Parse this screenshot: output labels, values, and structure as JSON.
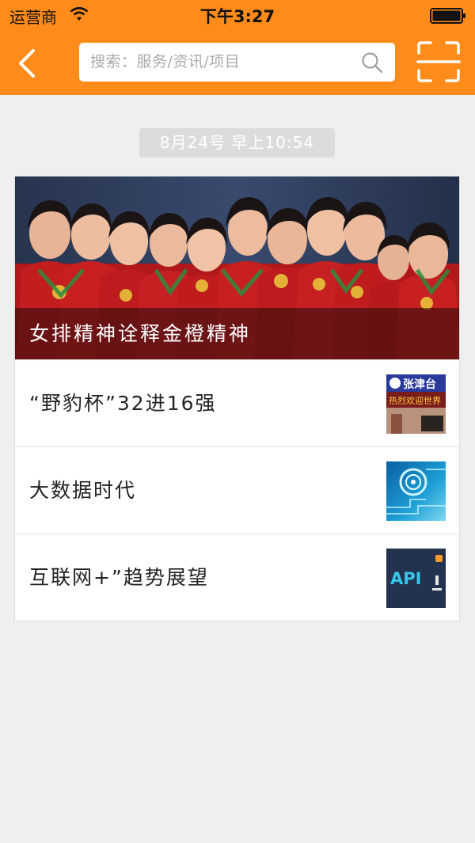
{
  "status_bar": {
    "carrier": "运营商",
    "time": "下午3:27"
  },
  "nav": {
    "back_icon": "chevron-left-icon",
    "scan_icon": "scan-frame-icon",
    "accent_color": "#ff8c1a"
  },
  "search": {
    "placeholder": "搜索：服务/资讯/项目",
    "icon": "search-icon"
  },
  "feed": {
    "timestamp": "8月24号 早上10:54",
    "featured": {
      "title": "女排精神诠释金橙精神"
    },
    "items": [
      {
        "title": "“野豹杯”32进16强",
        "thumb_text": "张津台",
        "thumb_subtext": "热烈欢迎世界"
      },
      {
        "title": "大数据时代"
      },
      {
        "title": "互联网+”趋势展望",
        "thumb_text": "API"
      }
    ]
  }
}
